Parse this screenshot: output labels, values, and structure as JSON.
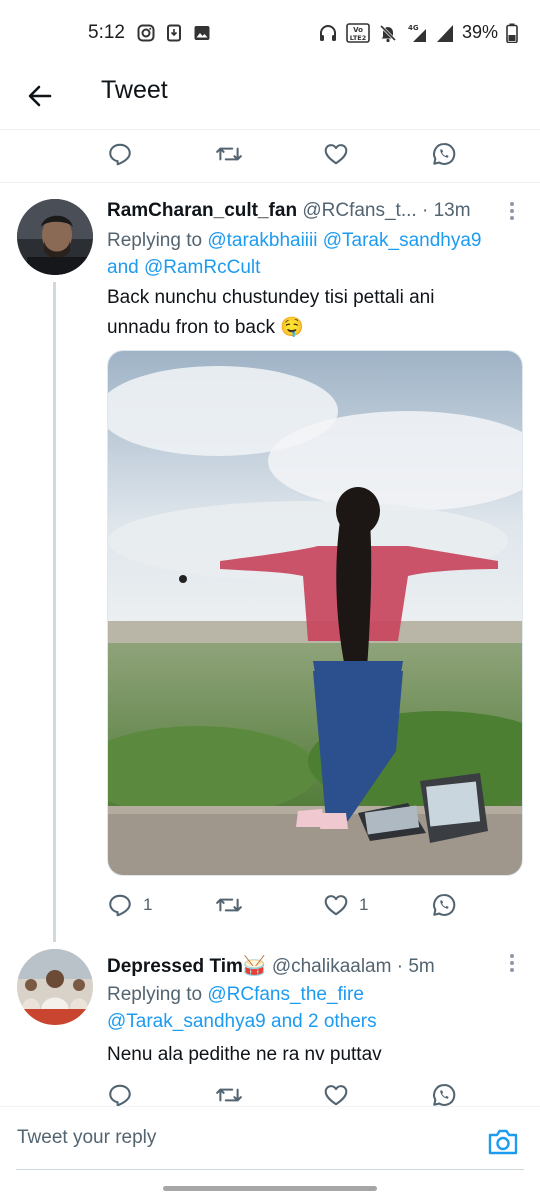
{
  "status_bar": {
    "time": "5:12",
    "battery": "39%",
    "volte_label": "Vo LTE 2",
    "network": "4G"
  },
  "header": {
    "title": "Tweet"
  },
  "tweets": [
    {
      "name": "RamCharan_cult_fan",
      "handle": "@RCfans_t...",
      "sep": " · ",
      "time": "13m",
      "replying_prefix": "Replying to ",
      "replying_users": [
        "@tarakbhaiiii",
        "@Tarak_sandhya9"
      ],
      "replying_and": "and ",
      "replying_last": "@RamRcCult",
      "text_line1": "Back nunchu chustundey tisi pettali ani",
      "text_line2": "unnadu fron to back 🤤",
      "replies": "1",
      "likes": "1"
    },
    {
      "name": "Depressed Tim🥁",
      "handle": "@chalikaalam",
      "sep": " · ",
      "time": "5m",
      "replying_prefix": "Replying to ",
      "replying_line1_user": "@RCfans_the_fire",
      "replying_line2_user": "@Tarak_sandhya9",
      "replying_line2_rest": " and 2 others",
      "text": "Nenu ala pedithe ne ra nv puttav"
    }
  ],
  "composer": {
    "placeholder": "Tweet your reply"
  },
  "colors": {
    "link": "#1d9bf0",
    "secondary_text": "#536471",
    "thread_line": "#cfd9de"
  },
  "icons": [
    "back-arrow-icon",
    "reply-icon",
    "retweet-icon",
    "like-icon",
    "whatsapp-icon",
    "more-icon",
    "camera-icon"
  ]
}
